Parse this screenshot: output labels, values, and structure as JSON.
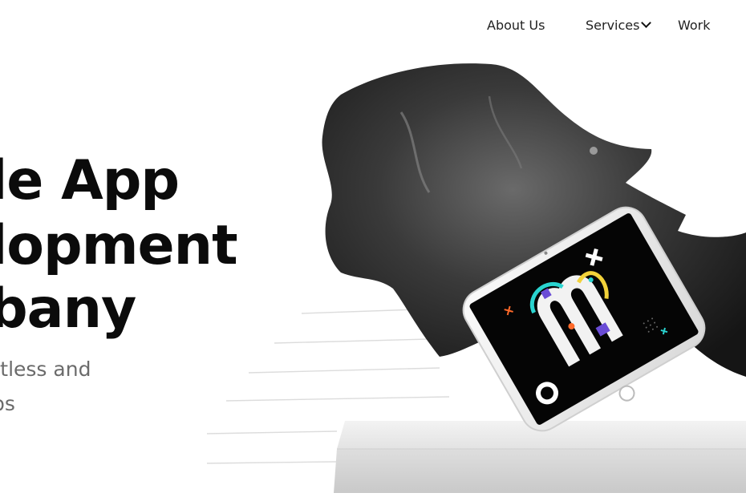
{
  "nav": {
    "about_label": "About Us",
    "services_label": "Services",
    "work_label": "Work"
  },
  "hero": {
    "line1": "le App",
    "line2": "lopment",
    "line3": "bany",
    "sub1": "rtless and",
    "sub2": "ps"
  },
  "colors": {
    "heading": "#0b0b0b",
    "subtext": "#6b6b6b",
    "nav_text": "#222222",
    "accent_cyan": "#2ad4d0",
    "accent_yellow": "#f2d23a",
    "accent_orange": "#ff6a2a",
    "accent_purple": "#6a4cd6"
  }
}
